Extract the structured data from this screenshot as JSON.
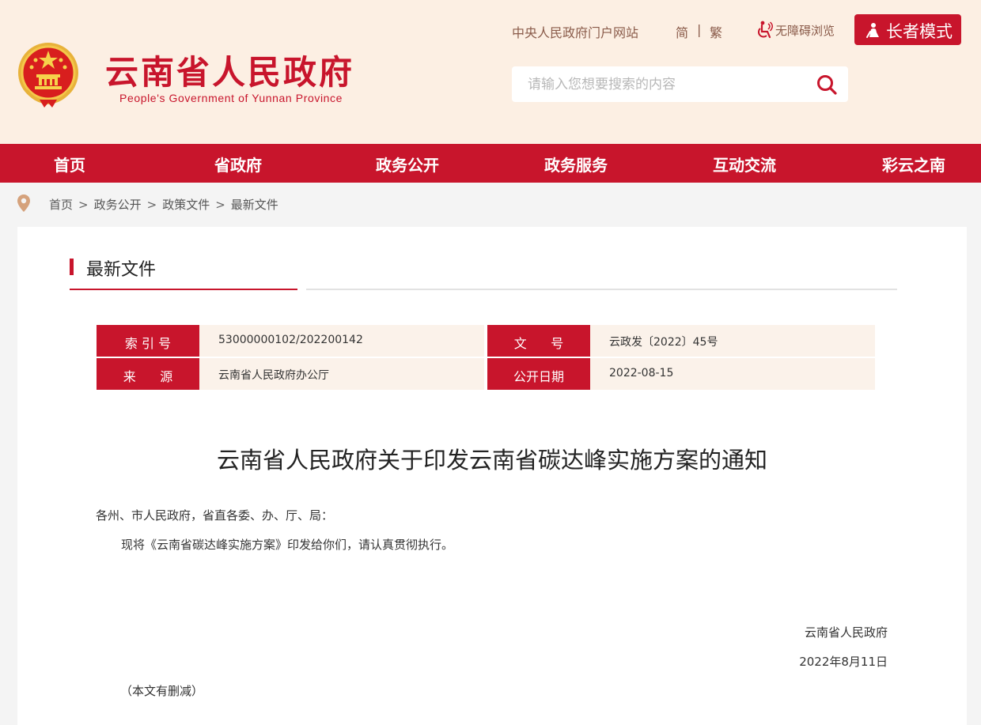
{
  "header": {
    "title_cn": "云南省人民政府",
    "title_en": "People's Government of Yunnan Province",
    "emblem_icon": "national-emblem-icon",
    "top_links": {
      "central": "中央人民政府门户网站",
      "simplified": "简",
      "separator": "|",
      "traditional": "繁",
      "accessibility": "无障碍浏览"
    },
    "elder_mode": "长者模式",
    "search": {
      "placeholder": "请输入您想要搜索的内容"
    }
  },
  "nav": [
    "首页",
    "省政府",
    "政务公开",
    "政务服务",
    "互动交流",
    "彩云之南"
  ],
  "breadcrumb": [
    "首页",
    "政务公开",
    "政策文件",
    "最新文件"
  ],
  "breadcrumb_separator": ">",
  "section": {
    "title": "最新文件"
  },
  "meta": {
    "index_label": "索 引 号",
    "index_value": "53000000102/202200142",
    "docno_label": "文      号",
    "docno_value": "云政发〔2022〕45号",
    "source_label": "来      源",
    "source_value": "云南省人民政府办公厅",
    "date_label": "公开日期",
    "date_value": "2022-08-15"
  },
  "document": {
    "title": "云南省人民政府关于印发云南省碳达峰实施方案的通知",
    "salutation": "各州、市人民政府，省直各委、办、厅、局：",
    "body": "现将《云南省碳达峰实施方案》印发给你们，请认真贯彻执行。",
    "issuer": "云南省人民政府",
    "date": "2022年8月11日",
    "note": "（本文有删减）"
  },
  "colors": {
    "brand_red": "#c8152c",
    "header_bg": "#fcefe3",
    "meta_value_bg": "#fbf2ea"
  }
}
